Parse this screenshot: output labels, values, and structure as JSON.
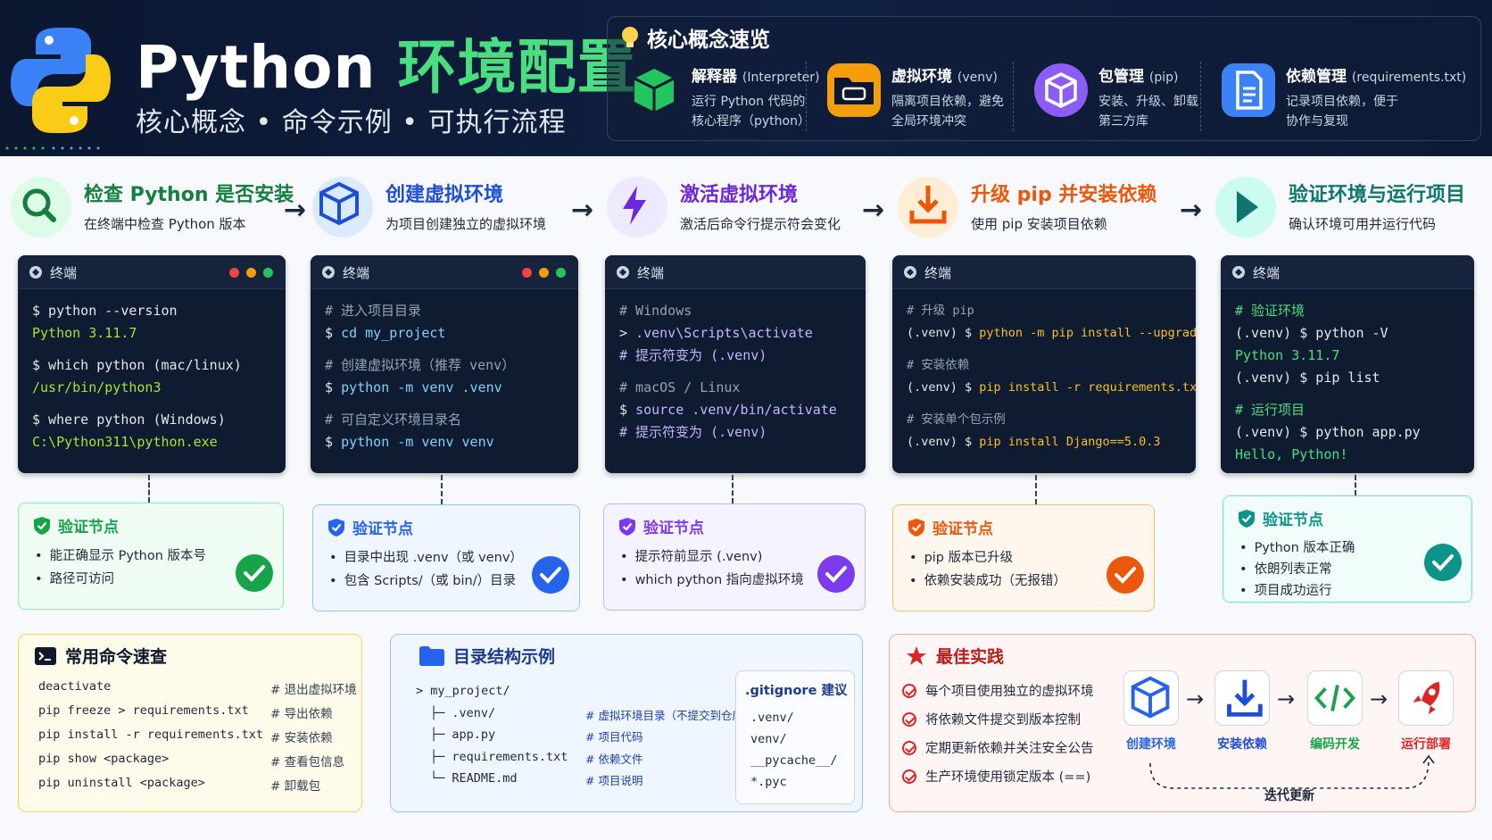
{
  "header": {
    "title_word": "Python",
    "title_accent": "环境配置",
    "subtitle": "核心概念 • 命令示例 • 可执行流程",
    "concepts_title": "核心概念速览",
    "concepts": [
      {
        "name": "解释器",
        "en": "(Interpreter)",
        "desc1": "运行 Python 代码的",
        "desc2": "核心程序（python）",
        "icon": "cube-icon",
        "color": "#22c55e"
      },
      {
        "name": "虚拟环境",
        "en": "(venv)",
        "desc1": "隔离项目依赖，避免",
        "desc2": "全局环境冲突",
        "icon": "folder-icon",
        "color": "#f59e0b"
      },
      {
        "name": "包管理",
        "en": "(pip)",
        "desc1": "安装、升级、卸载",
        "desc2": "第三方库",
        "icon": "package-icon",
        "color": "#8b5cf6"
      },
      {
        "name": "依赖管理",
        "en": "(requirements.txt)",
        "desc1": "记录项目依赖，便于",
        "desc2": "协作与复现",
        "icon": "document-icon",
        "color": "#3b82f6"
      }
    ]
  },
  "steps": [
    {
      "title": "检查 Python 是否安装",
      "desc": "在终端中检查 Python 版本",
      "color": "#15803d",
      "bg": "#dcfce7",
      "icon": "search-icon"
    },
    {
      "title": "创建虚拟环境",
      "desc": "为项目创建独立的虚拟环境",
      "color": "#1d4ed8",
      "bg": "#dbeafe",
      "icon": "cube-icon"
    },
    {
      "title": "激活虚拟环境",
      "desc": "激活后命令行提示符会变化",
      "color": "#6d28d9",
      "bg": "#ede9fe",
      "icon": "lightning-icon"
    },
    {
      "title": "升级 pip 并安装依赖",
      "desc": "使用 pip 安装项目依赖",
      "color": "#ea580c",
      "bg": "#ffedd5",
      "icon": "download-icon"
    },
    {
      "title": "验证环境与运行项目",
      "desc": "确认环境可用并运行代码",
      "color": "#0f766e",
      "bg": "#ccfbf1",
      "icon": "play-icon"
    }
  ],
  "terminal_label": "终端",
  "terminals": [
    [
      [
        {
          "t": "$ python --version",
          "c": "c-w"
        }
      ],
      [
        {
          "t": "Python 3.11.7",
          "c": "c-g"
        }
      ],
      [],
      [
        {
          "t": "$ which python  (mac/linux)",
          "c": "c-w"
        }
      ],
      [
        {
          "t": "/usr/bin/python3",
          "c": "c-g"
        }
      ],
      [],
      [
        {
          "t": "$ where python  (Windows)",
          "c": "c-w"
        }
      ],
      [
        {
          "t": "C:\\Python311\\python.exe",
          "c": "c-g"
        }
      ]
    ],
    [
      [
        {
          "t": "# 进入项目目录",
          "c": "c-gr"
        }
      ],
      [
        {
          "t": "$ ",
          "c": "c-w"
        },
        {
          "t": "cd my_project",
          "c": "c-b"
        }
      ],
      [],
      [
        {
          "t": "# 创建虚拟环境（推荐 venv）",
          "c": "c-gr"
        }
      ],
      [
        {
          "t": "$ ",
          "c": "c-w"
        },
        {
          "t": "python -m venv .venv",
          "c": "c-b"
        }
      ],
      [],
      [
        {
          "t": "# 可自定义环境目录名",
          "c": "c-gr"
        }
      ],
      [
        {
          "t": "$ ",
          "c": "c-w"
        },
        {
          "t": "python -m venv venv",
          "c": "c-b"
        }
      ]
    ],
    [
      [
        {
          "t": "# Windows",
          "c": "c-gr"
        }
      ],
      [
        {
          "t": "> ",
          "c": "c-w"
        },
        {
          "t": ".venv\\Scripts\\activate",
          "c": "c-p"
        }
      ],
      [
        {
          "t": "# 提示符变为 (.venv)",
          "c": "c-p"
        }
      ],
      [],
      [
        {
          "t": "# macOS / Linux",
          "c": "c-gr"
        }
      ],
      [
        {
          "t": "$ ",
          "c": "c-w"
        },
        {
          "t": "source .venv/bin/activate",
          "c": "c-p"
        }
      ],
      [
        {
          "t": "# 提示符变为 (.venv)",
          "c": "c-p"
        }
      ]
    ],
    [
      [
        {
          "t": "# 升级 pip",
          "c": "c-gr"
        }
      ],
      [
        {
          "t": "(.venv) $ ",
          "c": "c-w"
        },
        {
          "t": "python -m pip install --upgrade pip",
          "c": "c-o"
        }
      ],
      [],
      [
        {
          "t": "# 安装依赖",
          "c": "c-gr"
        }
      ],
      [
        {
          "t": "(.venv) $ ",
          "c": "c-w"
        },
        {
          "t": "pip install -r requirements.txt",
          "c": "c-o"
        }
      ],
      [],
      [
        {
          "t": "# 安装单个包示例",
          "c": "c-gr"
        }
      ],
      [
        {
          "t": "(.venv) $ ",
          "c": "c-w"
        },
        {
          "t": "pip install Django==5.0.3",
          "c": "c-o"
        }
      ]
    ],
    [
      [
        {
          "t": "# 验证环境",
          "c": "c-gn"
        }
      ],
      [
        {
          "t": "(.venv) $ python -V",
          "c": "c-w"
        }
      ],
      [
        {
          "t": "Python 3.11.7",
          "c": "c-gn"
        }
      ],
      [
        {
          "t": "(.venv) $ pip list",
          "c": "c-w"
        }
      ],
      [],
      [
        {
          "t": "# 运行项目",
          "c": "c-gn"
        }
      ],
      [
        {
          "t": "(.venv) $ python app.py",
          "c": "c-w"
        }
      ],
      [
        {
          "t": "Hello, Python!",
          "c": "c-gn"
        }
      ]
    ]
  ],
  "verify_label": "验证节点",
  "verify": [
    {
      "items": [
        "能正确显示 Python 版本号",
        "路径可访问"
      ],
      "color": "#16a34a",
      "bg": "#f0fdf4",
      "border": "#86efac"
    },
    {
      "items": [
        "目录中出现 .venv（或 venv）",
        "包含 Scripts/（或 bin/）目录"
      ],
      "color": "#2563eb",
      "bg": "#eff6ff",
      "border": "#93c5fd"
    },
    {
      "items": [
        "提示符前显示 (.venv)",
        "which python 指向虚拟环境"
      ],
      "color": "#7c3aed",
      "bg": "#f5f3ff",
      "border": "#c4b5fd"
    },
    {
      "items": [
        "pip 版本已升级",
        "依赖安装成功（无报错）"
      ],
      "color": "#ea580c",
      "bg": "#fff7ed",
      "border": "#fdba74"
    },
    {
      "items": [
        "Python 版本正确",
        "依朗列表正常",
        "项目成功运行"
      ],
      "color": "#0d9488",
      "bg": "#f0fdfa",
      "border": "#5eead4"
    }
  ],
  "commands": {
    "title": "常用命令速查",
    "rows": [
      {
        "cmd": "deactivate",
        "note": "# 退出虚拟环境"
      },
      {
        "cmd": "pip freeze > requirements.txt",
        "note": "# 导出依赖"
      },
      {
        "cmd": "pip install -r requirements.txt",
        "note": "# 安装依赖"
      },
      {
        "cmd": "pip show <package>",
        "note": "# 查看包信息"
      },
      {
        "cmd": "pip uninstall <package>",
        "note": "# 卸载包"
      }
    ]
  },
  "tree": {
    "title": "目录结构示例",
    "rows": [
      {
        "a": "> my_project/",
        "cm": "",
        "indent": 0
      },
      {
        "a": "├─ .venv/",
        "cm": "# 虚拟环境目录（不提交到仓库）",
        "indent": 1
      },
      {
        "a": "├─ app.py",
        "cm": "# 项目代码",
        "indent": 1
      },
      {
        "a": "├─ requirements.txt",
        "cm": "# 依赖文件",
        "indent": 1
      },
      {
        "a": "└─ README.md",
        "cm": "# 项目说明",
        "indent": 1
      }
    ],
    "gitignore_title": ".gitignore 建议",
    "gitignore": [
      ".venv/",
      "venv/",
      "__pycache__/",
      "*.pyc"
    ]
  },
  "best": {
    "title": "最佳实践",
    "items": [
      "每个项目使用独立的虚拟环境",
      "将依赖文件提交到版本控制",
      "定期更新依赖并关注安全公告",
      "生产环境使用锁定版本 (==)"
    ],
    "flow": [
      {
        "label": "创建环境",
        "icon": "cube-icon",
        "color": "#2563eb"
      },
      {
        "label": "安装依赖",
        "icon": "download-icon",
        "color": "#1d4ed8"
      },
      {
        "label": "编码开发",
        "icon": "code-icon",
        "color": "#16a34a"
      },
      {
        "label": "运行部署",
        "icon": "rocket-icon",
        "color": "#dc2626"
      }
    ],
    "loop_label": "迭代更新"
  }
}
